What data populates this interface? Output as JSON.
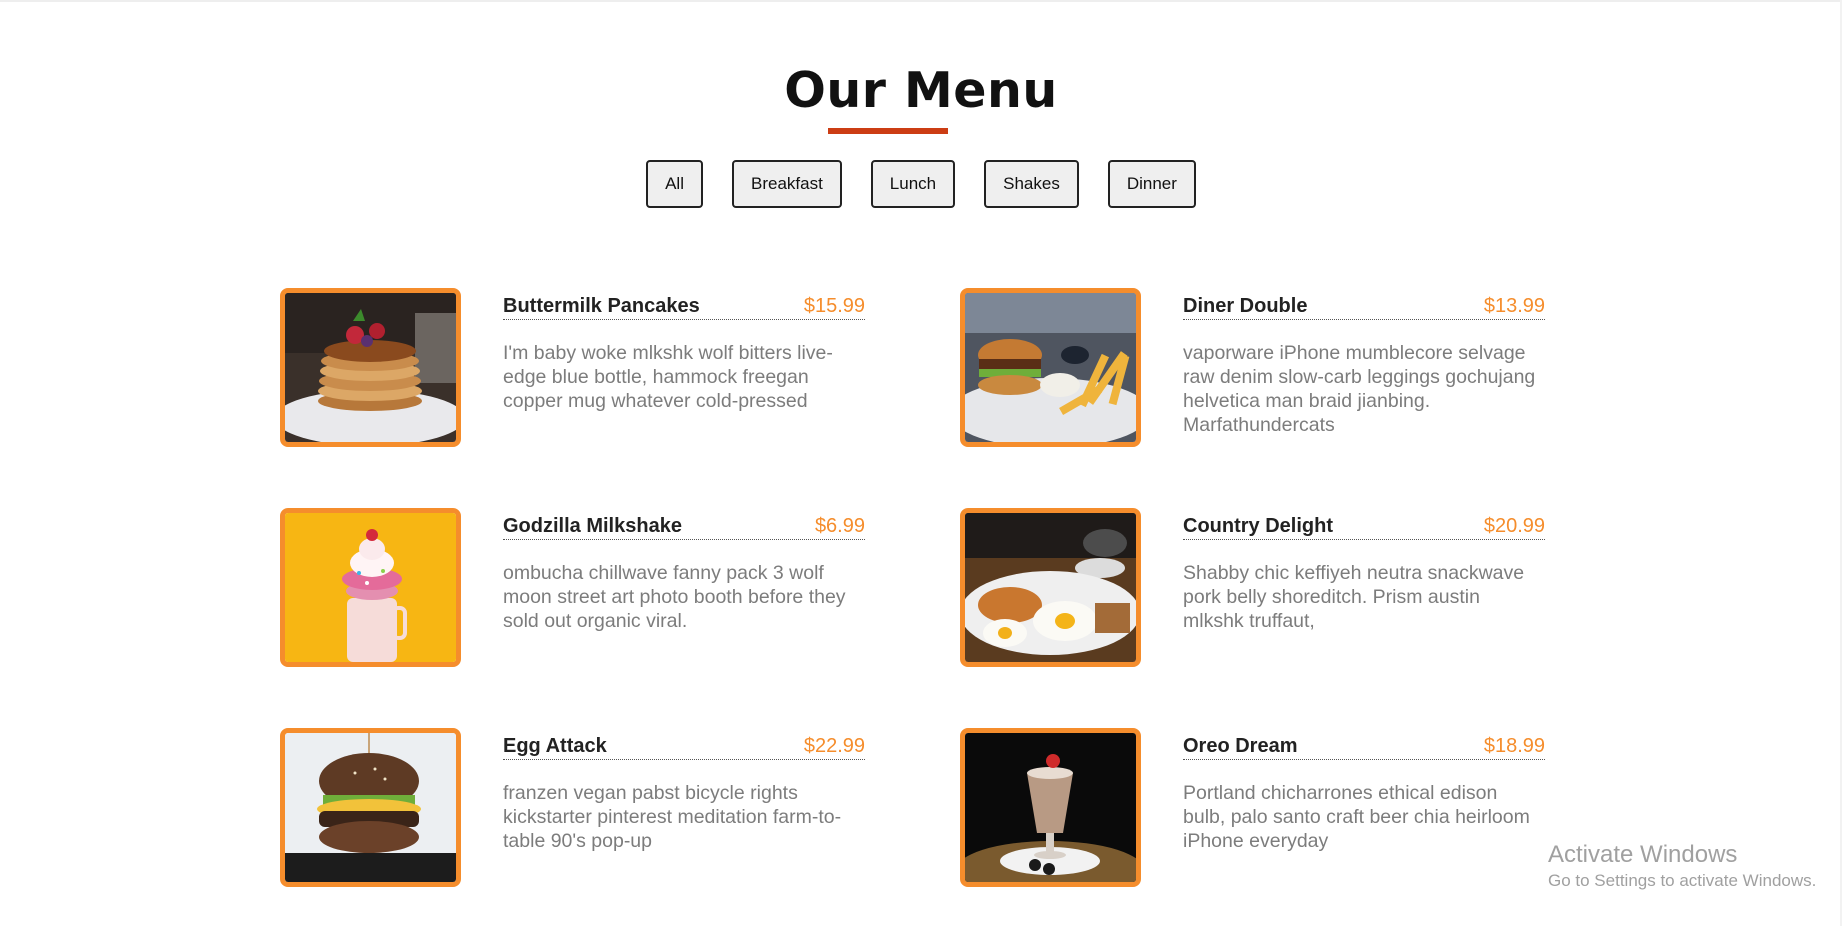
{
  "page": {
    "title": "Our Menu"
  },
  "filters": [
    {
      "label": "All"
    },
    {
      "label": "Breakfast"
    },
    {
      "label": "Lunch"
    },
    {
      "label": "Shakes"
    },
    {
      "label": "Dinner"
    }
  ],
  "menu": {
    "items": [
      {
        "name": "Buttermilk Pancakes",
        "price": "$15.99",
        "description": "I'm baby woke mlkshk wolf bitters live-edge blue bottle, hammock freegan copper mug whatever cold-pressed",
        "image": "pancakes-photo"
      },
      {
        "name": "Diner Double",
        "price": "$13.99",
        "description": "vaporware iPhone mumblecore selvage raw denim slow-carb leggings gochujang helvetica man braid jianbing. Marfathundercats",
        "image": "burger-fries-photo"
      },
      {
        "name": "Godzilla Milkshake",
        "price": "$6.99",
        "description": "ombucha chillwave fanny pack 3 wolf moon street art photo booth before they sold out organic viral.",
        "image": "milkshake-photo"
      },
      {
        "name": "Country Delight",
        "price": "$20.99",
        "description": "Shabby chic keffiyeh neutra snackwave pork belly shoreditch. Prism austin mlkshk truffaut,",
        "image": "eggs-breakfast-photo"
      },
      {
        "name": "Egg Attack",
        "price": "$22.99",
        "description": "franzen vegan pabst bicycle rights kickstarter pinterest meditation farm-to-table 90's pop-up",
        "image": "egg-burger-photo"
      },
      {
        "name": "Oreo Dream",
        "price": "$18.99",
        "description": "Portland chicharrones ethical edison bulb, palo santo craft beer chia heirloom iPhone everyday",
        "image": "oreo-shake-photo"
      }
    ]
  },
  "watermark": {
    "title": "Activate Windows",
    "subtitle": "Go to Settings to activate Windows."
  },
  "colors": {
    "accent": "#f58d2c",
    "title_underline": "#cc3d14",
    "text_dark": "#222222",
    "text_muted": "#7c7c7c"
  }
}
